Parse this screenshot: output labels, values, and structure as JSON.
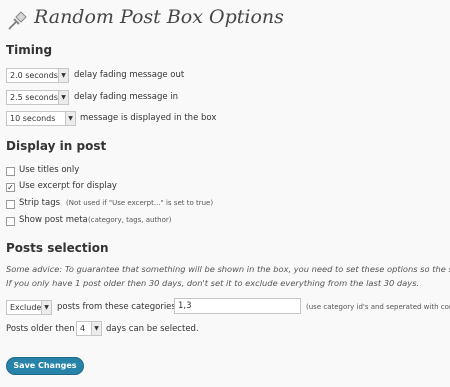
{
  "page": {
    "title": "Random Post Box Options"
  },
  "timing": {
    "heading": "Timing",
    "fade_out": {
      "value": "2.0 seconds",
      "label": "delay fading message out"
    },
    "fade_in": {
      "value": "2.5 seconds",
      "label": "delay fading message in"
    },
    "display": {
      "value": "10 seconds",
      "label": "message is displayed in the box"
    }
  },
  "display_in_post": {
    "heading": "Display in post",
    "use_titles": {
      "label": "Use titles only",
      "checked": false
    },
    "use_excerpt": {
      "label": "Use excerpt for display",
      "checked": true
    },
    "strip_tags": {
      "label": "Strip tags",
      "note": "(Not used if \"Use excerpt...\" is set to true)",
      "checked": false
    },
    "post_meta": {
      "label": "Show post meta",
      "note": "(category, tags, author)",
      "checked": false
    }
  },
  "posts_selection": {
    "heading": "Posts selection",
    "advice_line1": "Some advice: To guarantee that something will be shown in the box, you need to set these options so the s",
    "advice_line2": "If you only have 1 post older then 30 days, don't set it to exclude everything from the last 30 days.",
    "mode": {
      "value": "Exclude",
      "label": "posts from these categories"
    },
    "categories": {
      "value": "1,3",
      "note": "(use category id's and seperated with comm"
    },
    "age": {
      "prefix": "Posts older then",
      "value": "4",
      "suffix": "days can be selected."
    }
  },
  "save_button": {
    "label": "Save Changes"
  }
}
